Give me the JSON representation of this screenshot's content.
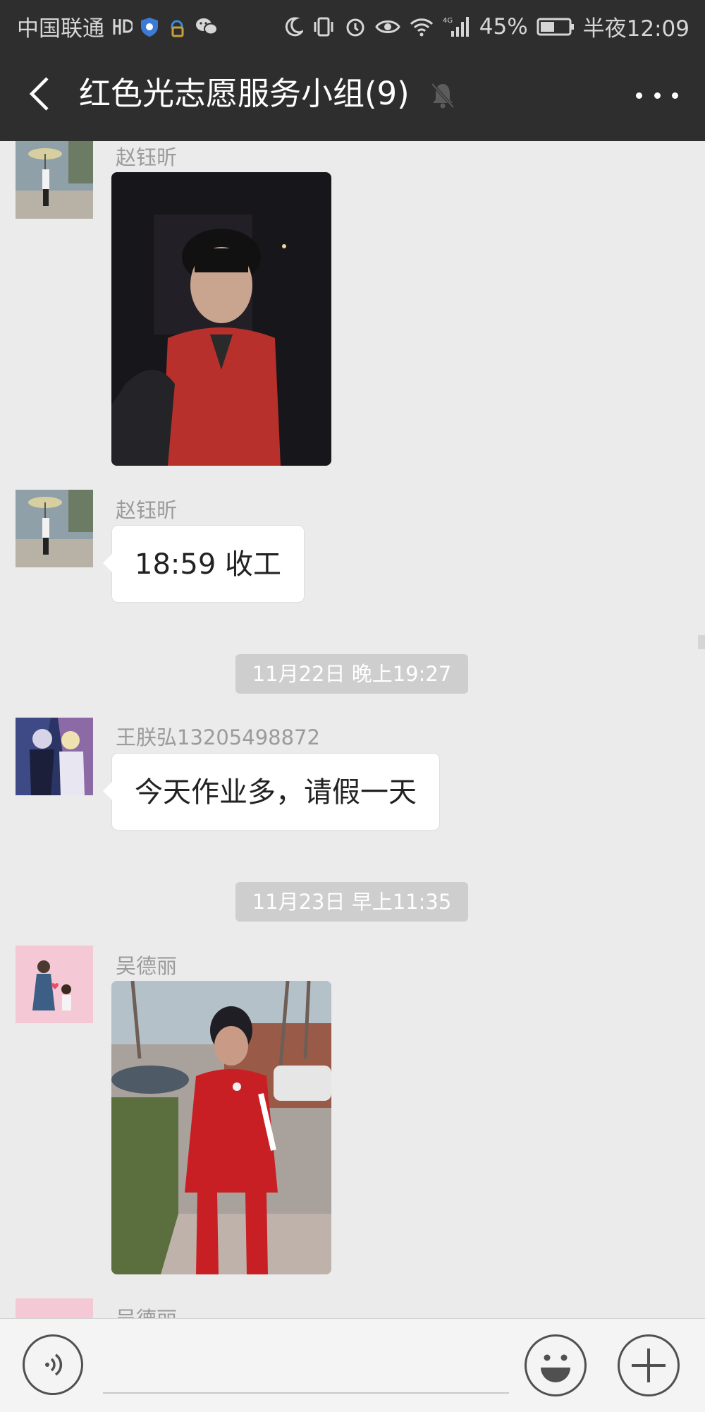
{
  "status_bar": {
    "carrier": "中国联通",
    "battery": "45%",
    "time": "半夜12:09",
    "network": "4G",
    "icons": [
      "hd-voice-icon",
      "shield-icon",
      "cloud-lock-icon",
      "wechat-icon",
      "moon-icon",
      "vibrate-icon",
      "alarm-icon",
      "eye-icon",
      "wifi-icon",
      "signal-icon",
      "battery-icon"
    ]
  },
  "header": {
    "title": "红色光志愿服务小组(9)",
    "icons": [
      "back-icon",
      "mute-bell-icon",
      "more-icon"
    ]
  },
  "messages": [
    {
      "type": "image",
      "sender": "赵钰昕",
      "avatar": "avatar-umbrella"
    },
    {
      "type": "text",
      "sender": "赵钰昕",
      "text": "18:59 收工",
      "avatar": "avatar-umbrella"
    },
    {
      "type": "timestamp",
      "text": "11月22日 晚上19:27"
    },
    {
      "type": "text",
      "sender": "王朕弘13205498872",
      "text": "今天作业多，请假一天",
      "avatar": "avatar-anime"
    },
    {
      "type": "timestamp",
      "text": "11月23日 早上11:35"
    },
    {
      "type": "image",
      "sender": "吴德丽",
      "avatar": "avatar-couple"
    },
    {
      "type": "partial",
      "sender": "吴德丽",
      "avatar": "avatar-couple"
    }
  ],
  "input_bar": {
    "icons": [
      "voice-icon",
      "emoji-icon",
      "plus-icon"
    ]
  },
  "colors": {
    "header_bg": "#2e2e2e",
    "chat_bg": "#ebebeb",
    "bubble_bg": "#ffffff",
    "timestamp_bg": "#cecece"
  }
}
